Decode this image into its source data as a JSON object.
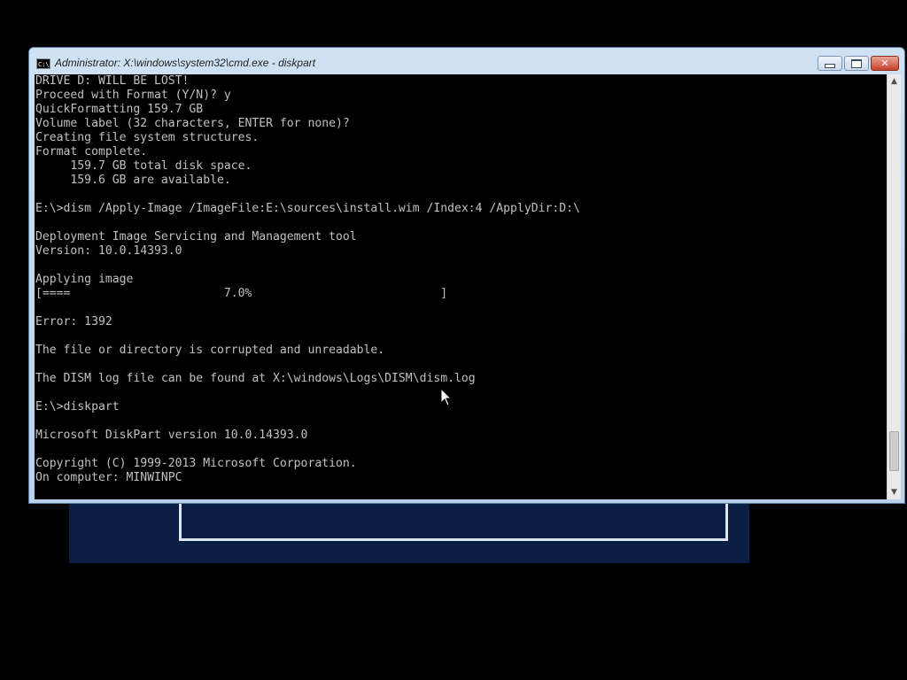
{
  "window": {
    "title": "Administrator: X:\\windows\\system32\\cmd.exe - diskpart",
    "icon": "cmd-icon",
    "icon_glyph": "C:\\",
    "minimize_icon": "minimize-icon",
    "maximize_icon": "maximize-icon",
    "close_icon": "close-icon",
    "close_glyph": "✕"
  },
  "console": {
    "lines": [
      "DRIVE D: WILL BE LOST!",
      "Proceed with Format (Y/N)? y",
      "QuickFormatting 159.7 GB",
      "Volume label (32 characters, ENTER for none)?",
      "Creating file system structures.",
      "Format complete.",
      "     159.7 GB total disk space.",
      "     159.6 GB are available.",
      "",
      "E:\\>dism /Apply-Image /ImageFile:E:\\sources\\install.wim /Index:4 /ApplyDir:D:\\",
      "",
      "Deployment Image Servicing and Management tool",
      "Version: 10.0.14393.0",
      "",
      "Applying image",
      "[====                      7.0%                           ]",
      "",
      "Error: 1392",
      "",
      "The file or directory is corrupted and unreadable.",
      "",
      "The DISM log file can be found at X:\\windows\\Logs\\DISM\\dism.log",
      "",
      "E:\\>diskpart",
      "",
      "Microsoft DiskPart version 10.0.14393.0",
      "",
      "Copyright (C) 1999-2013 Microsoft Corporation.",
      "On computer: MINWINPC"
    ],
    "apply_progress": 0.07
  },
  "scrollbar": {
    "up_icon": "scroll-up-arrow-icon",
    "up_glyph": "▲",
    "down_icon": "scroll-down-arrow-icon",
    "down_glyph": "▼",
    "position_fraction": 0.96,
    "visible_fraction": 0.1
  },
  "cursor": {
    "icon": "mouse-pointer-icon"
  }
}
